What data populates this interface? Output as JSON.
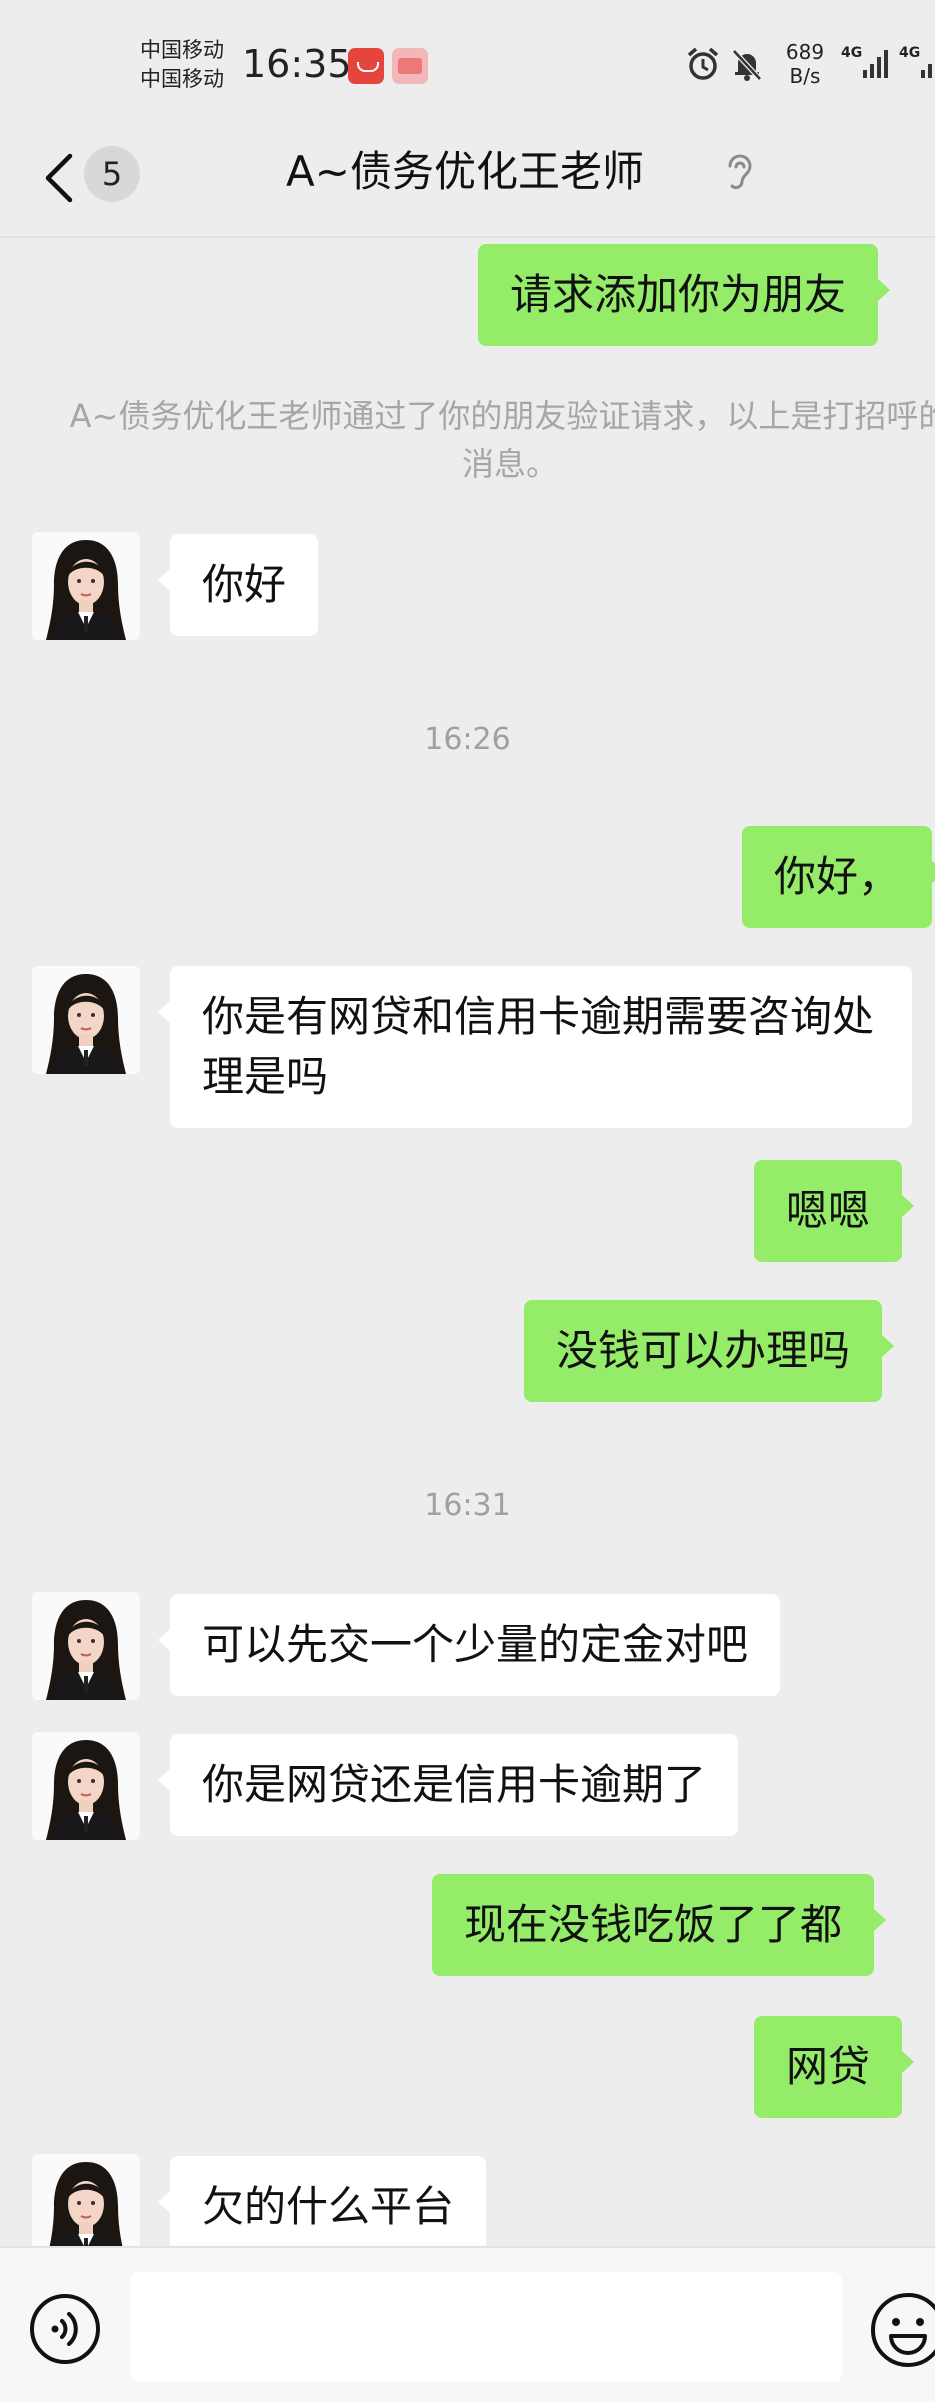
{
  "status_bar": {
    "carrier_1": "中国移动",
    "carrier_2": "中国移动",
    "time": "16:35",
    "net_speed_value": "689",
    "net_speed_unit": "B/s",
    "network_1": "4G",
    "network_2": "4G"
  },
  "header": {
    "unread_count": "5",
    "title": "A~债务优化王老师"
  },
  "messages": {
    "m1": "请求添加你为朋友",
    "system_note": "A~债务优化王老师通过了你的朋友验证请求，以上是打招呼的消息。",
    "m2": "你好",
    "time_1": "16:26",
    "m3": "你好，",
    "m4": "你是有网贷和信用卡逾期需要咨询处理是吗",
    "m5": "嗯嗯",
    "m6": "没钱可以办理吗",
    "time_2": "16:31",
    "m7": "可以先交一个少量的定金对吧",
    "m8": "你是网贷还是信用卡逾期了",
    "m9": "现在没钱吃饭了了都",
    "m10": "网贷",
    "m11": "欠的什么平台"
  },
  "input_bar": {
    "text_value": ""
  },
  "colors": {
    "background": "#ededed",
    "sent_bubble": "#95ec69",
    "received_bubble": "#ffffff",
    "secondary_text": "#a6a6a6"
  },
  "icons": {
    "alarm": "alarm-icon",
    "mute": "bell-off-icon",
    "signal": "signal-bars-icon",
    "back": "chevron-left-icon",
    "earpiece": "ear-icon",
    "voice": "voice-icon",
    "emoji": "emoji-icon"
  }
}
